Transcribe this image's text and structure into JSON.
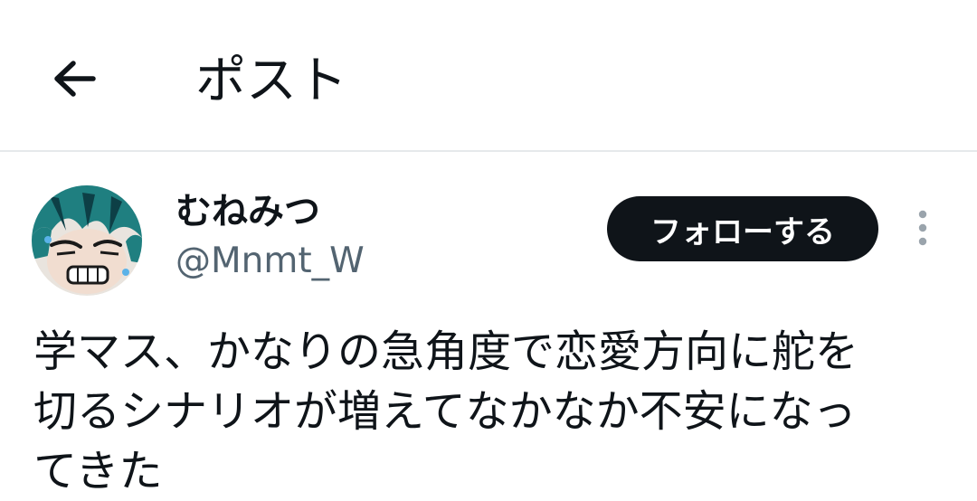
{
  "header": {
    "back_icon": "arrow-left-icon",
    "title": "ポスト"
  },
  "author": {
    "avatar_icon": "user-avatar-illustration",
    "display_name": "むねみつ",
    "handle": "@Mnmt_W"
  },
  "actions": {
    "follow_label": "フォローする",
    "more_icon": "more-vertical-icon"
  },
  "post": {
    "text": "学マス、かなりの急角度で恋愛方向に舵を\n切るシナリオが増えてなかなか不安になっ\nてきた"
  },
  "colors": {
    "text_primary": "#0f1419",
    "text_secondary": "#536471",
    "divider": "#e6e9eb",
    "follow_bg": "#0f1419",
    "follow_text": "#ffffff",
    "avatar_hair": "#1f7f80"
  }
}
